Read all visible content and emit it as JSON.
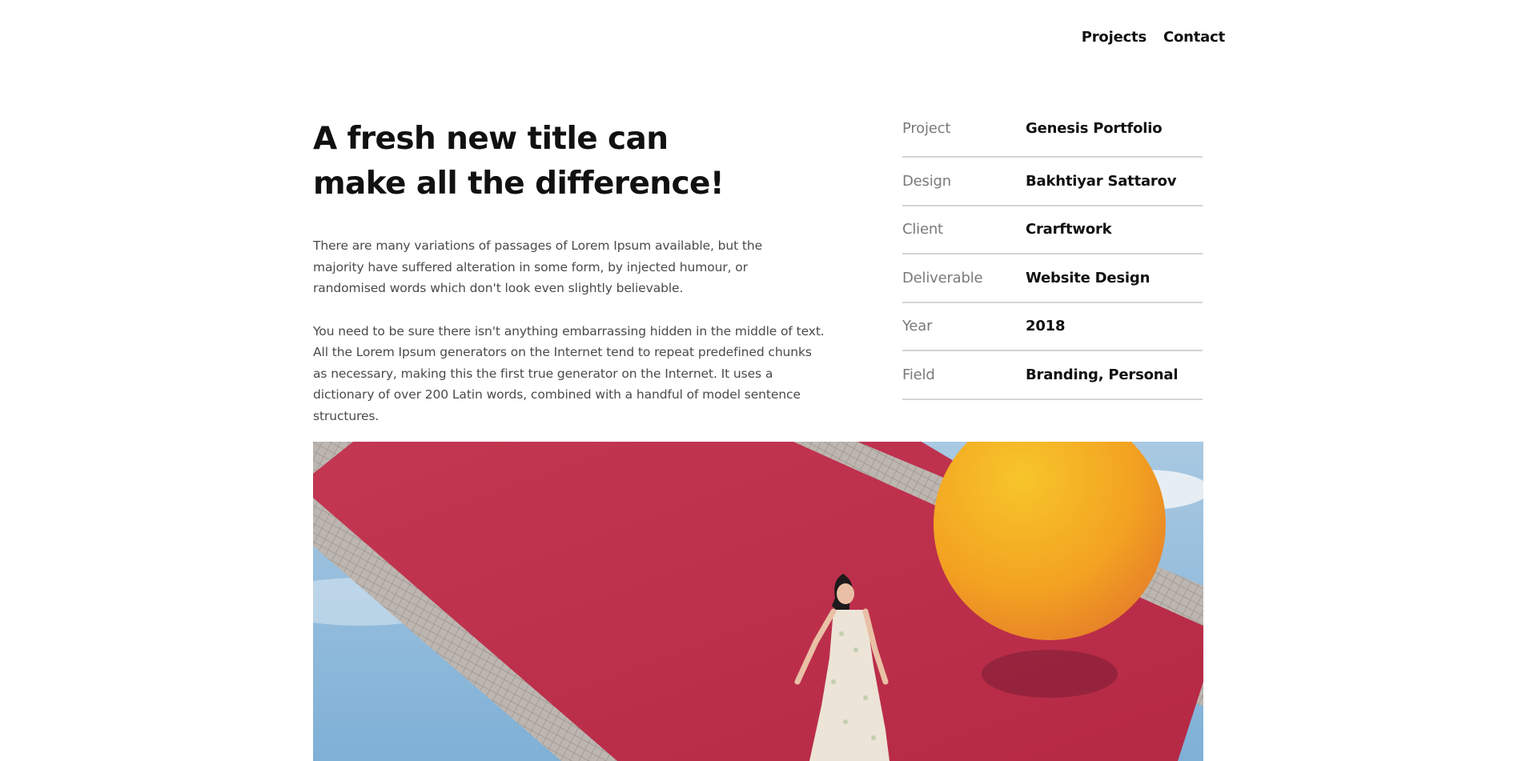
{
  "nav": {
    "items": [
      "Projects",
      "Contact"
    ]
  },
  "intro": {
    "title_line1": "A fresh new title can",
    "title_line2": "make all the difference!",
    "paragraph1": "There are many variations of passages of Lorem Ipsum available, but the majority have suffered alteration in some form, by injected humour, or randomised words which don't look even slightly believable.",
    "paragraph2": "You need to be sure there isn't anything embarrassing hidden in the middle of text. All the Lorem Ipsum generators on the Internet tend to repeat predefined chunks as necessary, making this the first true generator on the Internet. It uses a dictionary of over 200 Latin words, combined with a handful of model sentence structures."
  },
  "meta": {
    "rows": [
      {
        "label": "Project",
        "value": "Genesis Portfolio"
      },
      {
        "label": "Design",
        "value": "Bakhtiyar Sattarov"
      },
      {
        "label": "Client",
        "value": "Crarftwork"
      },
      {
        "label": "Deliverable",
        "value": "Website Design"
      },
      {
        "label": "Year",
        "value": "2018"
      },
      {
        "label": "Field",
        "value": "Branding, Personal"
      }
    ]
  },
  "hero": {
    "colors": {
      "sky": "#8fb8d8",
      "carpet": "#c2344f",
      "paving": "#b9b1ab",
      "sphere": "#f2a51f"
    }
  }
}
